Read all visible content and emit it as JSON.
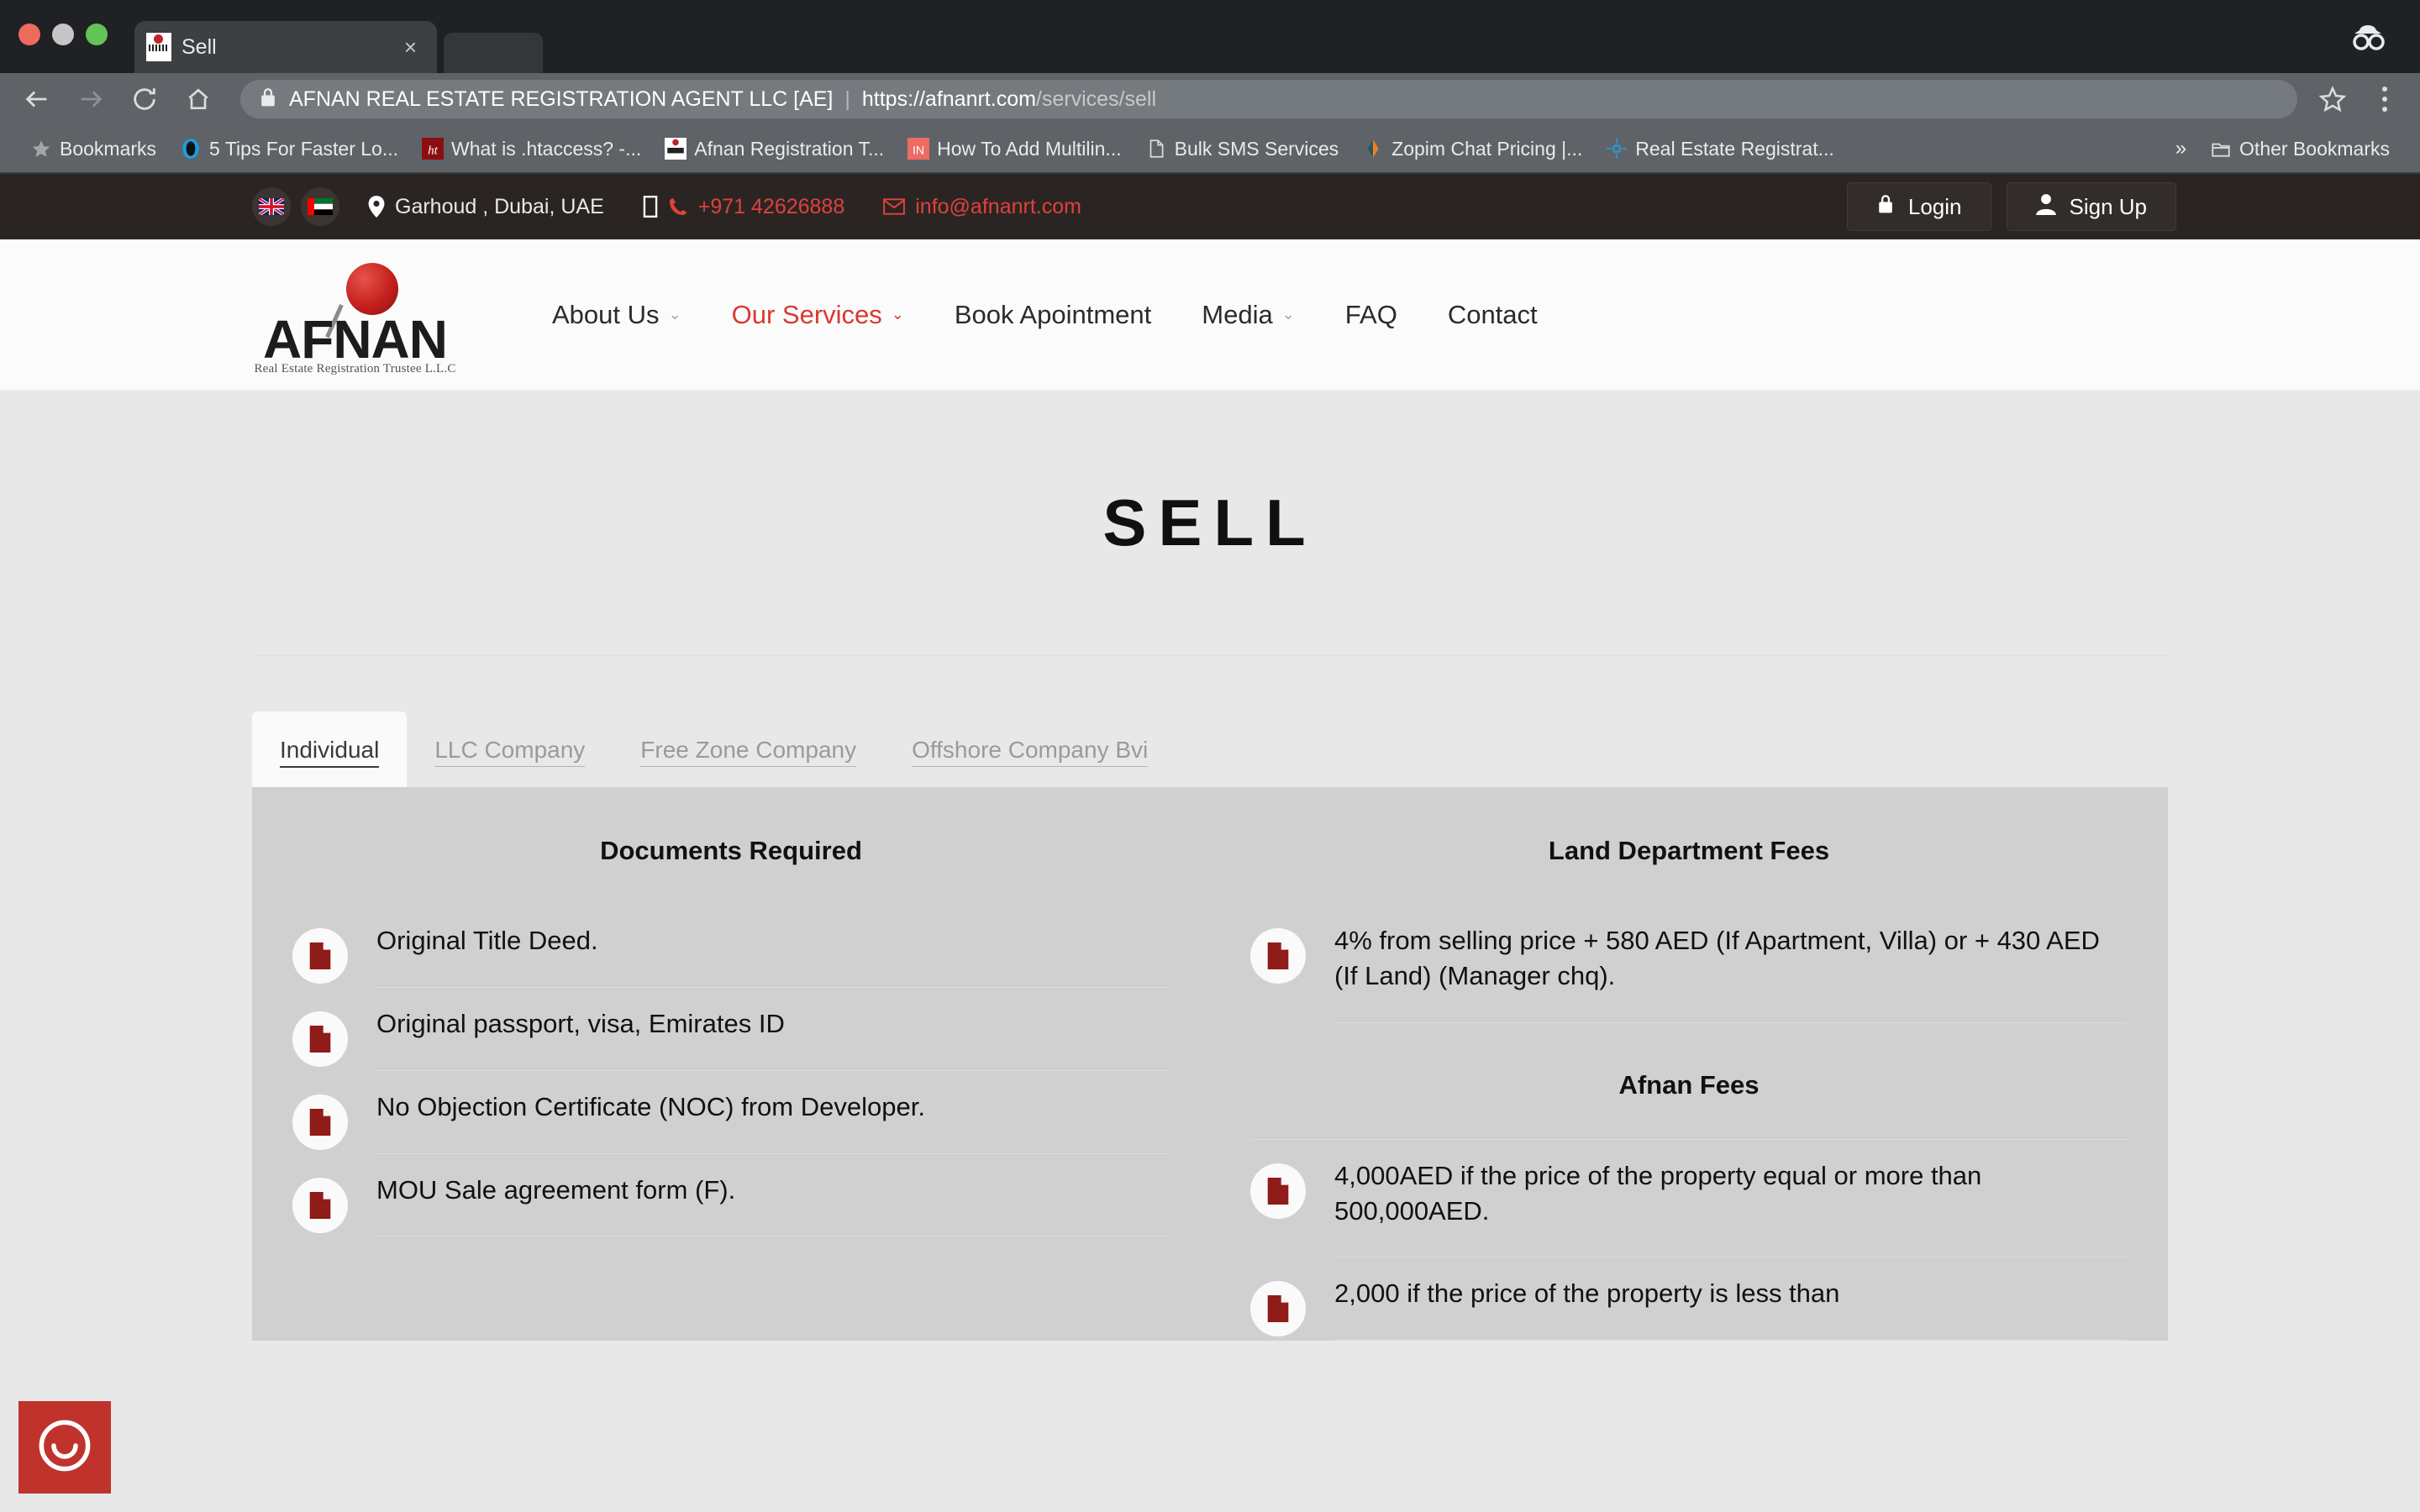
{
  "browser": {
    "tab": {
      "title": "Sell",
      "close_label": "×",
      "favicon": "afnan-favicon"
    },
    "omnibox": {
      "lock_icon": "lock-icon",
      "site_name": "AFNAN REAL ESTATE REGISTRATION AGENT LLC [AE]",
      "separator": "|",
      "url_scheme_host": "https://afnanrt.com",
      "url_path": "/services/sell"
    },
    "nav": {
      "back": "←",
      "forward": "→",
      "reload": "↻",
      "home": "⌂"
    },
    "bookmarks_bar": {
      "label": "Bookmarks",
      "items": [
        {
          "label": "5 Tips For Faster Lo...",
          "icon": "blue-circle-icon"
        },
        {
          "label": "What is .htaccess? -...",
          "icon": "htaccess-icon"
        },
        {
          "label": "Afnan Registration T...",
          "icon": "afnan-favicon"
        },
        {
          "label": "How To Add Multilin...",
          "icon": "linkedin-icon"
        },
        {
          "label": "Bulk SMS Services",
          "icon": "page-icon"
        },
        {
          "label": "Zopim Chat Pricing |...",
          "icon": "zopim-icon"
        },
        {
          "label": "Real Estate Registrat...",
          "icon": "blue-gear-icon"
        }
      ],
      "overflow": "»",
      "other_bookmarks": "Other Bookmarks",
      "other_bookmarks_icon": "folder-icon"
    },
    "incognito_icon": "incognito-icon",
    "star_icon": "star-icon",
    "menu_icon": "kebab-menu-icon"
  },
  "site": {
    "topbar": {
      "flags": [
        {
          "name": "flag-uk"
        },
        {
          "name": "flag-uae"
        }
      ],
      "location_icon": "map-pin-icon",
      "location": "Garhoud , Dubai, UAE",
      "mobile_icon": "mobile-icon",
      "phone_icon": "phone-icon",
      "phone": "+971 42626888",
      "mail_icon": "envelope-icon",
      "email": "info@afnanrt.com",
      "login": {
        "label": "Login",
        "icon": "lock-icon"
      },
      "signup": {
        "label": "Sign Up",
        "icon": "user-icon"
      }
    },
    "logo": {
      "word": "AFNAN",
      "tagline": "Real Estate Registration Trustee L.L.C"
    },
    "nav_items": [
      {
        "label": "About Us",
        "caret": "⌄",
        "active": false
      },
      {
        "label": "Our Services",
        "caret": "⌄",
        "active": true
      },
      {
        "label": "Book Apointment",
        "caret": "",
        "active": false
      },
      {
        "label": "Media",
        "caret": "⌄",
        "active": false
      },
      {
        "label": "FAQ",
        "caret": "",
        "active": false
      },
      {
        "label": "Contact",
        "caret": "",
        "active": false
      }
    ],
    "hero_title": "SELL",
    "page_tabs": [
      {
        "label": "Individual",
        "active": true
      },
      {
        "label": "LLC Company",
        "active": false
      },
      {
        "label": "Free Zone Company",
        "active": false
      },
      {
        "label": "Offshore Company Bvi",
        "active": false
      }
    ],
    "left_column": {
      "title": "Documents Required",
      "items": [
        "Original Title Deed.",
        "Original passport, visa, Emirates ID",
        "No Objection Certificate (NOC) from Developer.",
        "MOU Sale agreement form (F)."
      ]
    },
    "right_column": {
      "title": "Land Department Fees",
      "items": [
        "4% from selling price + 580 AED (If Apartment, Villa) or + 430 AED (If Land) (Manager chq)."
      ],
      "second_title": "Afnan Fees",
      "second_items": [
        "4,000AED if the price of the property equal or more than 500,000AED.",
        "2,000 if the price of the property is less than"
      ]
    },
    "chat_widget_icon": "chat-smiley-icon",
    "colors": {
      "accent_red": "#d9382f",
      "dark_bar": "#2a2523",
      "panel_gray": "#d0d0d0",
      "page_gray": "#e8e8e8",
      "doc_icon_red": "#8f1c18"
    }
  }
}
